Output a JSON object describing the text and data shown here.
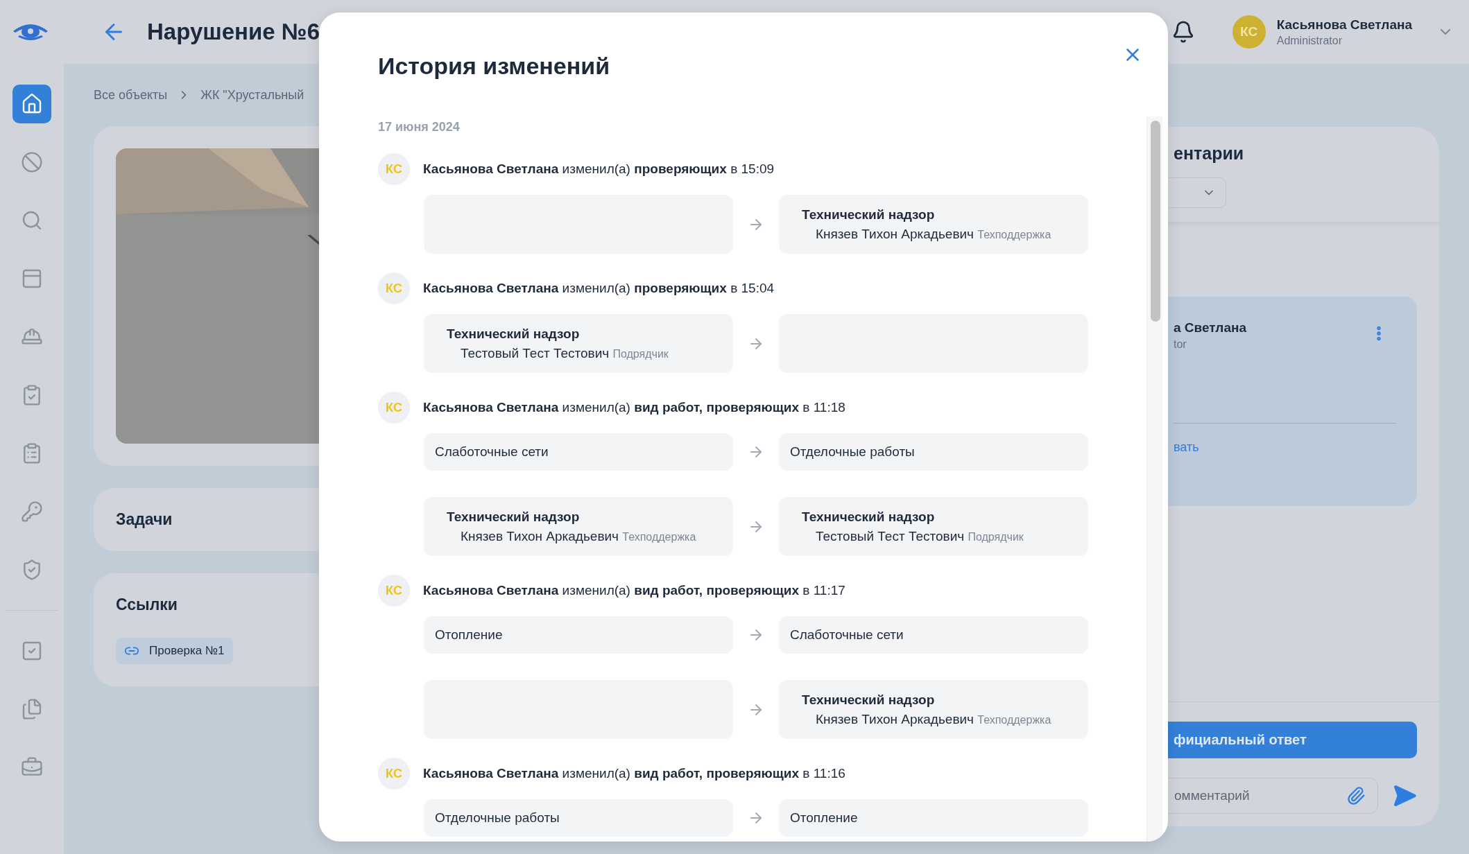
{
  "header": {
    "title": "Нарушение №6",
    "user": {
      "initials": "КС",
      "name": "Касьянова Светлана",
      "role": "Administrator"
    }
  },
  "sidebar": {
    "items": [
      {
        "kind": "home",
        "selected": true
      },
      {
        "kind": "ban",
        "selected": false
      },
      {
        "kind": "search",
        "selected": false
      },
      {
        "kind": "panel",
        "selected": false
      },
      {
        "kind": "helmet",
        "selected": false
      },
      {
        "kind": "clipcheck",
        "selected": false
      },
      {
        "kind": "clipboard",
        "selected": false
      },
      {
        "kind": "key",
        "selected": false
      },
      {
        "kind": "shield",
        "selected": false
      },
      {
        "kind": "divider"
      },
      {
        "kind": "checkbox",
        "selected": false
      },
      {
        "kind": "files",
        "selected": false
      },
      {
        "kind": "case",
        "selected": false
      }
    ]
  },
  "breadcrumbs": [
    "Все объекты",
    "ЖК \"Хрустальный"
  ],
  "tasks": {
    "title": "Задачи"
  },
  "links": {
    "title": "Ссылки",
    "items": [
      "Проверка №1"
    ]
  },
  "comments": {
    "title": "ентарии",
    "comment": {
      "author": "а Светлана",
      "role": "tor",
      "action": "вать"
    },
    "official_button": "фициальный ответ",
    "input": {
      "placeholder": "омментарий"
    }
  },
  "modal": {
    "title": "История изменений",
    "date": "17 июня 2024",
    "entries": [
      {
        "initials": "КС",
        "summary": "**Касьянова Светлана** изменил(а) **проверяющих** в 15:09",
        "changes": [
          {
            "from": {
              "kind": "empty"
            },
            "to": {
              "kind": "person",
              "group": "Технический надзор",
              "name": "Князев Тихон Аркадьевич",
              "role": "Техподдержка"
            }
          }
        ]
      },
      {
        "initials": "КС",
        "summary": "**Касьянова Светлана** изменил(а) **проверяющих** в 15:04",
        "changes": [
          {
            "from": {
              "kind": "person",
              "group": "Технический надзор",
              "name": "Тестовый Тест Тестович",
              "role": "Подрядчик"
            },
            "to": {
              "kind": "empty"
            }
          }
        ]
      },
      {
        "initials": "КС",
        "summary": "**Касьянова Светлана** изменил(а) **вид работ, проверяющих** в 11:18",
        "changes": [
          {
            "from": {
              "kind": "text",
              "text": "Слаботочные сети"
            },
            "to": {
              "kind": "text",
              "text": "Отделочные работы"
            }
          },
          {
            "from": {
              "kind": "person",
              "group": "Технический надзор",
              "name": "Князев Тихон Аркадьевич",
              "role": "Техподдержка"
            },
            "to": {
              "kind": "person",
              "group": "Технический надзор",
              "name": "Тестовый Тест Тестович",
              "role": "Подрядчик"
            }
          }
        ]
      },
      {
        "initials": "КС",
        "summary": "**Касьянова Светлана** изменил(а) **вид работ, проверяющих** в 11:17",
        "changes": [
          {
            "from": {
              "kind": "text",
              "text": "Отопление"
            },
            "to": {
              "kind": "text",
              "text": "Слаботочные сети"
            }
          },
          {
            "from": {
              "kind": "empty"
            },
            "to": {
              "kind": "person",
              "group": "Технический надзор",
              "name": "Князев Тихон Аркадьевич",
              "role": "Техподдержка"
            }
          }
        ]
      },
      {
        "initials": "КС",
        "summary": "**Касьянова Светлана** изменил(а) **вид работ, проверяющих** в 11:16",
        "changes": [
          {
            "from": {
              "kind": "text",
              "text": "Отделочные работы"
            },
            "to": {
              "kind": "text",
              "text": "Отопление"
            }
          }
        ]
      }
    ]
  }
}
